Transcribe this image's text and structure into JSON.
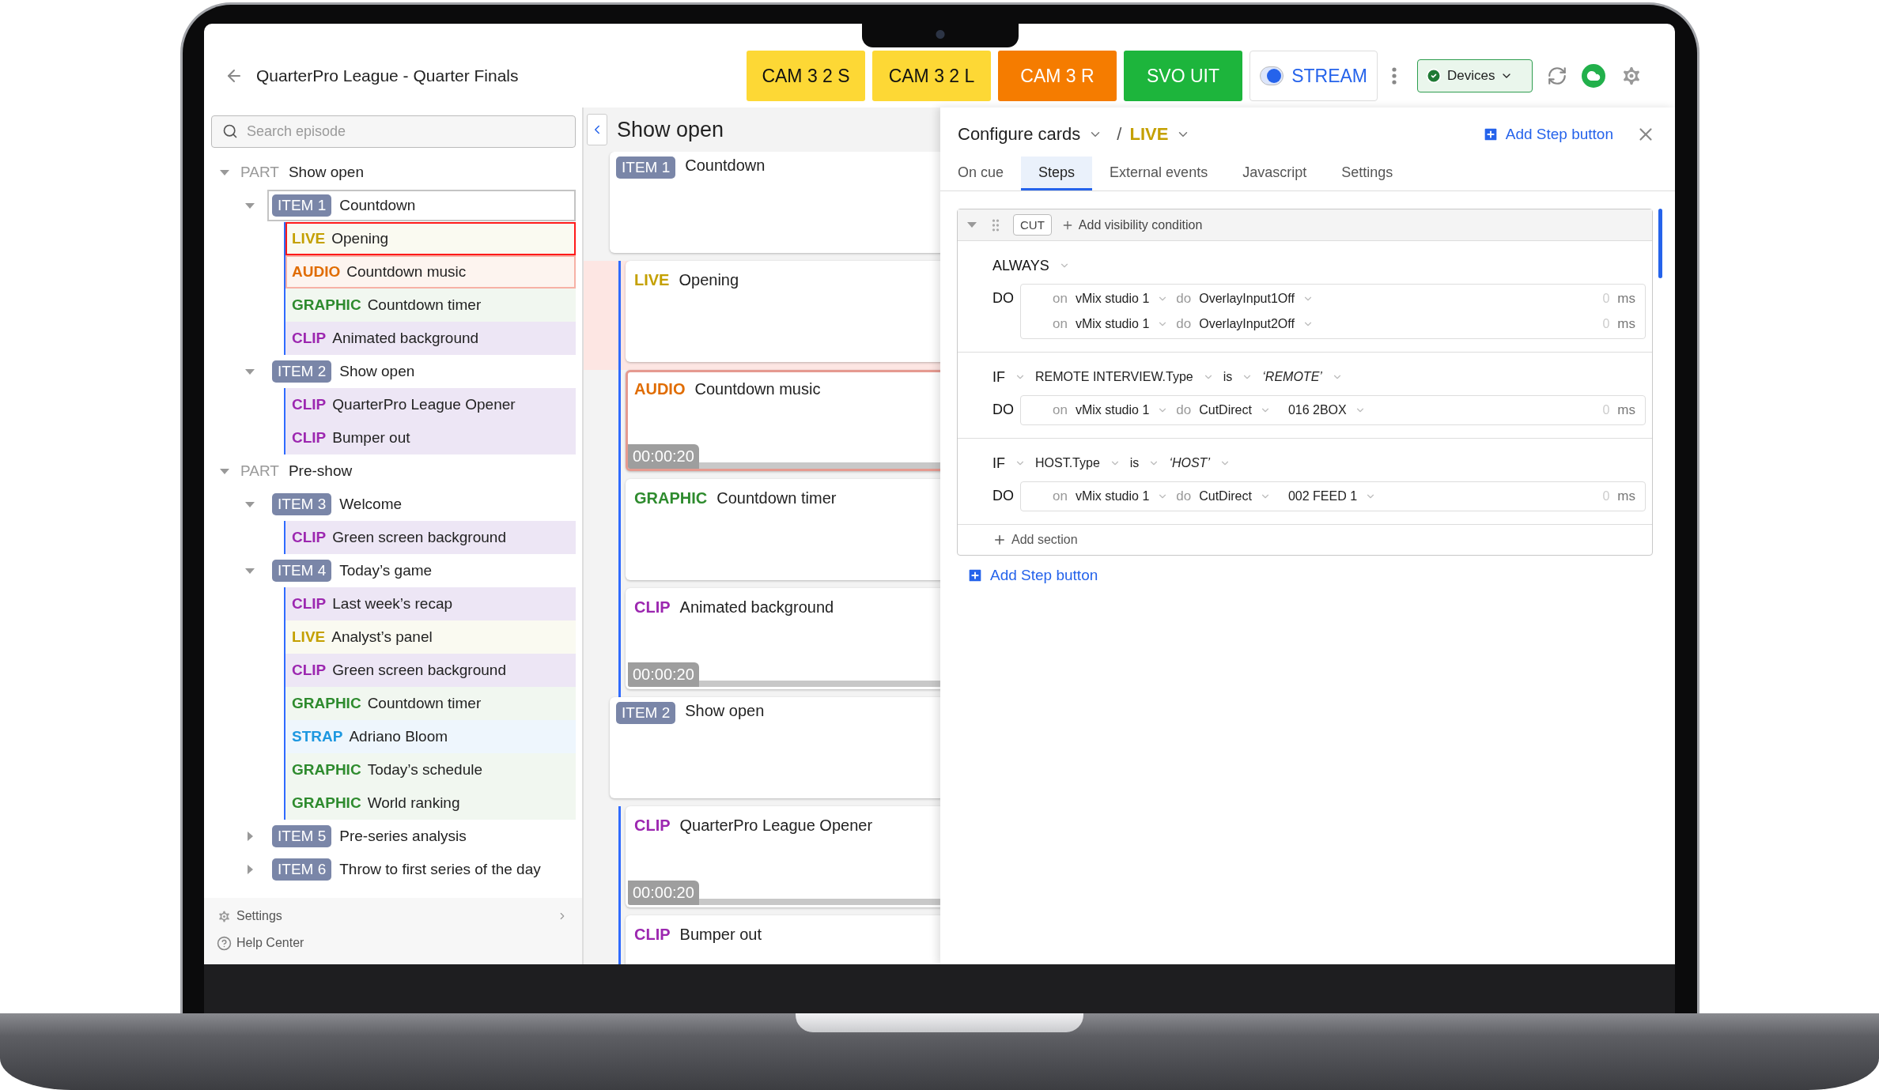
{
  "header": {
    "title": "QuarterPro League - Quarter Finals",
    "cameras": [
      {
        "label": "CAM 3 2 S",
        "color": "#fdd835"
      },
      {
        "label": "CAM 3 2 L",
        "color": "#fdd835"
      },
      {
        "label": "CAM 3 R",
        "color": "#f57c00"
      },
      {
        "label": "SVO UIT",
        "color": "#1db53c"
      }
    ],
    "stream": {
      "label": "STREAM",
      "on": true
    },
    "devices": {
      "label": "Devices"
    }
  },
  "sidebar": {
    "search": {
      "placeholder": "Search episode"
    },
    "tree": [
      {
        "kind": "part",
        "tag": "PART",
        "title": "Show open",
        "expanded": true,
        "children": [
          {
            "kind": "item",
            "tag": "ITEM 1",
            "title": "Countdown",
            "expanded": true,
            "selected": true,
            "children": [
              {
                "kind": "live",
                "tag": "LIVE",
                "title": "Opening",
                "on_air": true,
                "cued": false
              },
              {
                "kind": "audio",
                "tag": "AUDIO",
                "title": "Countdown music",
                "on_air": false,
                "cued": true
              },
              {
                "kind": "graphic",
                "tag": "GRAPHIC",
                "title": "Countdown timer",
                "on_air": false,
                "cued": false
              },
              {
                "kind": "clip",
                "tag": "CLIP",
                "title": "Animated background",
                "on_air": false,
                "cued": false
              }
            ]
          },
          {
            "kind": "item",
            "tag": "ITEM 2",
            "title": "Show open",
            "expanded": true,
            "selected": false,
            "children": [
              {
                "kind": "clip",
                "tag": "CLIP",
                "title": "QuarterPro League Opener",
                "on_air": false,
                "cued": false
              },
              {
                "kind": "clip",
                "tag": "CLIP",
                "title": "Bumper out",
                "on_air": false,
                "cued": false
              }
            ]
          }
        ]
      },
      {
        "kind": "part",
        "tag": "PART",
        "title": "Pre-show",
        "expanded": true,
        "children": [
          {
            "kind": "item",
            "tag": "ITEM 3",
            "title": "Welcome",
            "expanded": true,
            "selected": false,
            "children": [
              {
                "kind": "clip",
                "tag": "CLIP",
                "title": "Green screen background",
                "on_air": false,
                "cued": false
              }
            ]
          },
          {
            "kind": "item",
            "tag": "ITEM 4",
            "title": "Today’s game",
            "expanded": true,
            "selected": false,
            "children": [
              {
                "kind": "clip",
                "tag": "CLIP",
                "title": "Last week’s recap",
                "on_air": false,
                "cued": false
              },
              {
                "kind": "live",
                "tag": "LIVE",
                "title": "Analyst’s panel",
                "on_air": false,
                "cued": false
              },
              {
                "kind": "clip",
                "tag": "CLIP",
                "title": "Green screen background",
                "on_air": false,
                "cued": false
              },
              {
                "kind": "graphic",
                "tag": "GRAPHIC",
                "title": "Countdown timer",
                "on_air": false,
                "cued": false
              },
              {
                "kind": "strap",
                "tag": "STRAP",
                "title": "Adriano Bloom",
                "on_air": false,
                "cued": false
              },
              {
                "kind": "graphic",
                "tag": "GRAPHIC",
                "title": "Today’s schedule",
                "on_air": false,
                "cued": false
              },
              {
                "kind": "graphic",
                "tag": "GRAPHIC",
                "title": "World ranking",
                "on_air": false,
                "cued": false
              }
            ]
          },
          {
            "kind": "item",
            "tag": "ITEM 5",
            "title": "Pre-series analysis",
            "expanded": false,
            "selected": false
          },
          {
            "kind": "item",
            "tag": "ITEM 6",
            "title": "Throw to first series of the day",
            "expanded": false,
            "selected": false
          }
        ]
      }
    ],
    "footer": [
      {
        "kind": "settings",
        "label": "Settings"
      },
      {
        "kind": "help",
        "label": "Help Center"
      }
    ]
  },
  "rundown": {
    "title": "Show open",
    "cards": [
      {
        "kind": "item",
        "tag": "ITEM 1",
        "title": "Countdown"
      },
      {
        "kind": "live",
        "tag": "LIVE",
        "title": "Opening",
        "on_air": true,
        "cued": false
      },
      {
        "kind": "audio",
        "tag": "AUDIO",
        "title": "Countdown music",
        "on_air": false,
        "cued": true,
        "duration": "00:00:20"
      },
      {
        "kind": "graphic",
        "tag": "GRAPHIC",
        "title": "Countdown timer",
        "on_air": false,
        "cued": false
      },
      {
        "kind": "clip",
        "tag": "CLIP",
        "title": "Animated background",
        "on_air": false,
        "cued": false,
        "duration": "00:00:20"
      },
      {
        "kind": "item",
        "tag": "ITEM 2",
        "title": "Show open"
      },
      {
        "kind": "clip",
        "tag": "CLIP",
        "title": "QuarterPro League Opener",
        "on_air": false,
        "cued": false,
        "duration": "00:00:20"
      },
      {
        "kind": "clip",
        "tag": "CLIP",
        "title": "Bumper out",
        "on_air": false,
        "cued": false
      }
    ]
  },
  "editor": {
    "title": "Configure cards",
    "separator": "/",
    "card_type": {
      "kind": "live",
      "tag": "LIVE"
    },
    "add_step_top": "Add Step button",
    "tabs": [
      {
        "label": "On cue",
        "selected": false
      },
      {
        "label": "Steps",
        "selected": true
      },
      {
        "label": "External events",
        "selected": false
      },
      {
        "label": "Javascript",
        "selected": false
      },
      {
        "label": "Settings",
        "selected": false
      }
    ],
    "step": {
      "trigger": "CUT",
      "add_condition": "Add visibility condition",
      "expanded": true,
      "sections": [
        {
          "kind": "always",
          "condition": "ALWAYS",
          "do_label": "DO",
          "actions": [
            {
              "on": "on",
              "target": "vMix studio 1",
              "do": "do",
              "command": "OverlayInput1Off",
              "delay": "0",
              "unit": "ms"
            },
            {
              "on": "on",
              "target": "vMix studio 1",
              "do": "do",
              "command": "OverlayInput2Off",
              "delay": "0",
              "unit": "ms"
            }
          ]
        },
        {
          "kind": "if",
          "condition": "IF",
          "field": "REMOTE INTERVIEW.Type",
          "operator": "is",
          "value": "‘REMOTE’",
          "do_label": "DO",
          "actions": [
            {
              "on": "on",
              "target": "vMix studio 1",
              "do": "do",
              "command": "CutDirect",
              "input": "016 2BOX",
              "delay": "0",
              "unit": "ms"
            }
          ]
        },
        {
          "kind": "if",
          "condition": "IF",
          "field": "HOST.Type",
          "operator": "is",
          "value": "‘HOST’",
          "do_label": "DO",
          "actions": [
            {
              "on": "on",
              "target": "vMix studio 1",
              "do": "do",
              "command": "CutDirect",
              "input": "002 FEED 1",
              "delay": "0",
              "unit": "ms"
            }
          ]
        }
      ],
      "add_section": "Add section"
    },
    "add_step_bottom": "Add Step button"
  }
}
